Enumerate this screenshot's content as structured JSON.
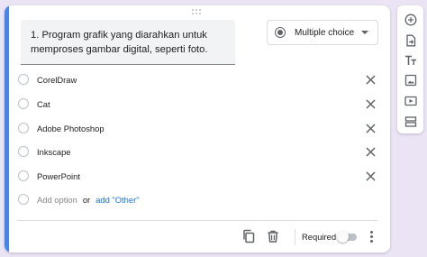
{
  "question": {
    "text": "1. Program grafik yang diarahkan untuk memproses gambar digital, seperti foto.",
    "type_label": "Multiple choice"
  },
  "options": [
    {
      "label": "CorelDraw"
    },
    {
      "label": "Cat"
    },
    {
      "label": "Adobe Photoshop"
    },
    {
      "label": "Inkscape"
    },
    {
      "label": "PowerPoint"
    }
  ],
  "add_option": {
    "label": "Add option",
    "or": "or",
    "other": "add \"Other\""
  },
  "footer": {
    "required_label": "Required",
    "required": false
  },
  "colors": {
    "accent": "#4285f4",
    "link": "#1a73e8",
    "background": "#ebe4f5"
  },
  "toolbar": {
    "icons": [
      "add-question-icon",
      "import-questions-icon",
      "add-title-icon",
      "add-image-icon",
      "add-video-icon",
      "add-section-icon"
    ]
  }
}
